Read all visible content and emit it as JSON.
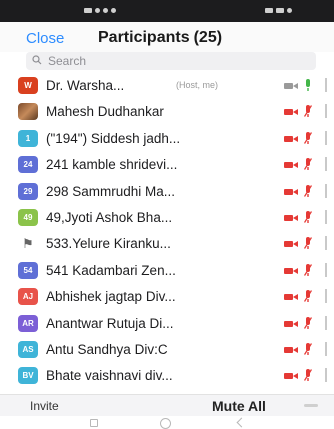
{
  "header": {
    "close_label": "Close",
    "title": "Participants",
    "count": "(25)"
  },
  "search": {
    "placeholder": "Search"
  },
  "participants": [
    {
      "name": "Dr. Warsha...",
      "tag": "(Host, me)",
      "avatar_text": "W",
      "avatar_color": "#d9401f",
      "avatar_kind": "letter",
      "video": "on",
      "mic": "on"
    },
    {
      "name": "Mahesh Dudhankar",
      "tag": "",
      "avatar_text": "",
      "avatar_color": "#8a5a34",
      "avatar_kind": "photo",
      "video": "off",
      "mic": "muted"
    },
    {
      "name": "(\"194\") Siddesh jadh...",
      "tag": "",
      "avatar_text": "1",
      "avatar_color": "#3fb4d8",
      "avatar_kind": "letter",
      "video": "off",
      "mic": "muted"
    },
    {
      "name": "241 kamble shridevi...",
      "tag": "",
      "avatar_text": "24",
      "avatar_color": "#5f6fd6",
      "avatar_kind": "letter",
      "video": "off",
      "mic": "muted"
    },
    {
      "name": "298 Sammrudhi Ma...",
      "tag": "",
      "avatar_text": "29",
      "avatar_color": "#5f6fd6",
      "avatar_kind": "letter",
      "video": "off",
      "mic": "muted"
    },
    {
      "name": "49,Jyoti Ashok Bha...",
      "tag": "",
      "avatar_text": "49",
      "avatar_color": "#8bc34a",
      "avatar_kind": "letter",
      "video": "off",
      "mic": "muted"
    },
    {
      "name": "533.Yelure Kiranku...",
      "tag": "",
      "avatar_text": "⚑",
      "avatar_color": "#ffffff",
      "avatar_kind": "plain",
      "video": "off",
      "mic": "muted"
    },
    {
      "name": "541 Kadambari Zen...",
      "tag": "",
      "avatar_text": "54",
      "avatar_color": "#5f6fd6",
      "avatar_kind": "letter",
      "video": "off",
      "mic": "muted"
    },
    {
      "name": "Abhishek jagtap Div...",
      "tag": "",
      "avatar_text": "AJ",
      "avatar_color": "#e8534a",
      "avatar_kind": "letter",
      "video": "off",
      "mic": "muted"
    },
    {
      "name": "Anantwar Rutuja Di...",
      "tag": "",
      "avatar_text": "AR",
      "avatar_color": "#7c5fd6",
      "avatar_kind": "letter",
      "video": "off",
      "mic": "muted"
    },
    {
      "name": "Antu Sandhya Div:C",
      "tag": "",
      "avatar_text": "AS",
      "avatar_color": "#3fb4d8",
      "avatar_kind": "letter",
      "video": "off",
      "mic": "muted"
    },
    {
      "name": "Bhate vaishnavi div...",
      "tag": "",
      "avatar_text": "BV",
      "avatar_color": "#3fb4d8",
      "avatar_kind": "letter",
      "video": "off",
      "mic": "muted"
    }
  ],
  "footer": {
    "invite_label": "Invite",
    "mute_all_label": "Mute All"
  },
  "colors": {
    "accent": "#2d8cff",
    "muted": "#e53935",
    "active": "#43b649",
    "video_on": "#9a9a9a"
  },
  "icons": {
    "search": "magnifier-icon",
    "video_off": "video-off-icon",
    "mic_muted": "mic-muted-icon",
    "mic_on": "mic-on-icon"
  }
}
